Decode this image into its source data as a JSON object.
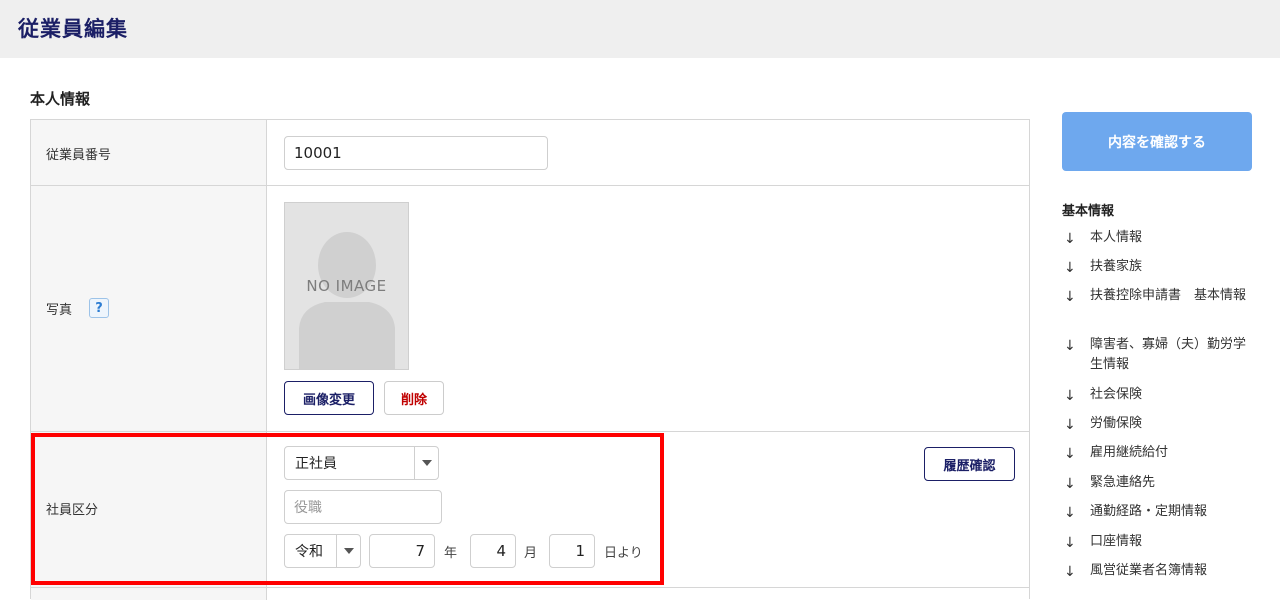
{
  "page": {
    "title": "従業員編集"
  },
  "section": {
    "title": "本人情報"
  },
  "fields": {
    "employee_number": {
      "label": "従業員番号",
      "value": "10001"
    },
    "photo": {
      "label": "写真",
      "help": "?",
      "no_image": "NO IMAGE",
      "change_label": "画像変更",
      "delete_label": "削除"
    },
    "employee_type": {
      "label": "社員区分",
      "selected": "正社員",
      "position_placeholder": "役職",
      "era": "令和",
      "year": "7",
      "year_unit": "年",
      "month": "4",
      "month_unit": "月",
      "day": "1",
      "day_unit": "日より",
      "history_label": "履歴確認"
    }
  },
  "sidebar": {
    "confirm_label": "内容を確認する",
    "nav_title": "基本情報",
    "arrow": "↓",
    "items": [
      "本人情報",
      "扶養家族",
      "扶養控除申請書　基本情報",
      "障害者、寡婦（夫）勤労学生情報",
      "社会保険",
      "労働保険",
      "雇用継続給付",
      "緊急連絡先",
      "通勤経路・定期情報",
      "口座情報",
      "風営従業者名簿情報"
    ]
  },
  "colors": {
    "title": "#1b1f66",
    "accent_button": "#6ea8ee",
    "danger": "#c00000",
    "highlight": "#ff0000"
  }
}
